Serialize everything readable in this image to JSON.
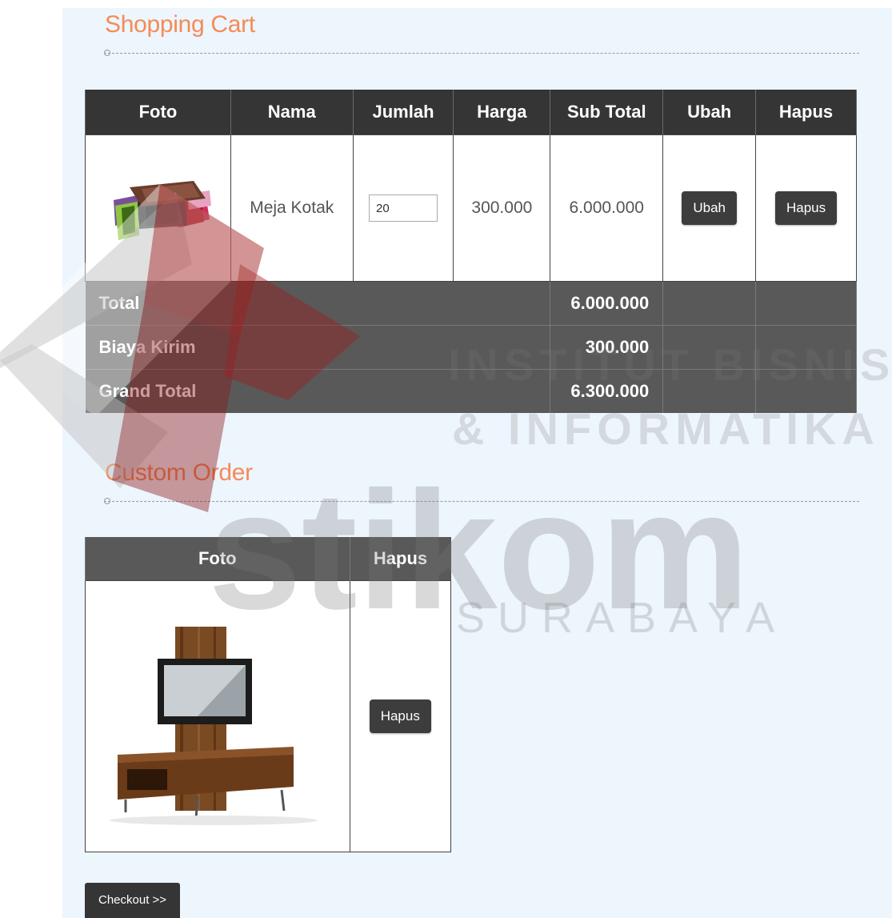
{
  "shopping_cart": {
    "title": "Shopping Cart",
    "columns": [
      "Foto",
      "Nama",
      "Jumlah",
      "Harga",
      "Sub Total",
      "Ubah",
      "Hapus"
    ],
    "items": [
      {
        "photo_icon": "table-furniture-icon",
        "name": "Meja Kotak",
        "quantity": "20",
        "price": "300.000",
        "subtotal": "6.000.000",
        "edit_label": "Ubah",
        "delete_label": "Hapus"
      }
    ],
    "totals": [
      {
        "label": "Total",
        "value": "6.000.000"
      },
      {
        "label": "Biaya Kirim",
        "value": "300.000"
      },
      {
        "label": "Grand Total",
        "value": "6.300.000"
      }
    ]
  },
  "custom_order": {
    "title": "Custom Order",
    "columns": [
      "Foto",
      "Hapus"
    ],
    "items": [
      {
        "photo_icon": "tv-stand-icon",
        "delete_label": "Hapus"
      }
    ]
  },
  "checkout_label": "Checkout >>",
  "watermark": {
    "line1": "INSTITUT BISNIS",
    "line2": "& INFORMATIKA",
    "line3": "stikom",
    "line4": "SURABAYA"
  },
  "colors": {
    "title": "#f58b57",
    "header_dark": "#353535",
    "footer_gray": "#595959",
    "panel_bg": "#edf5fd"
  }
}
